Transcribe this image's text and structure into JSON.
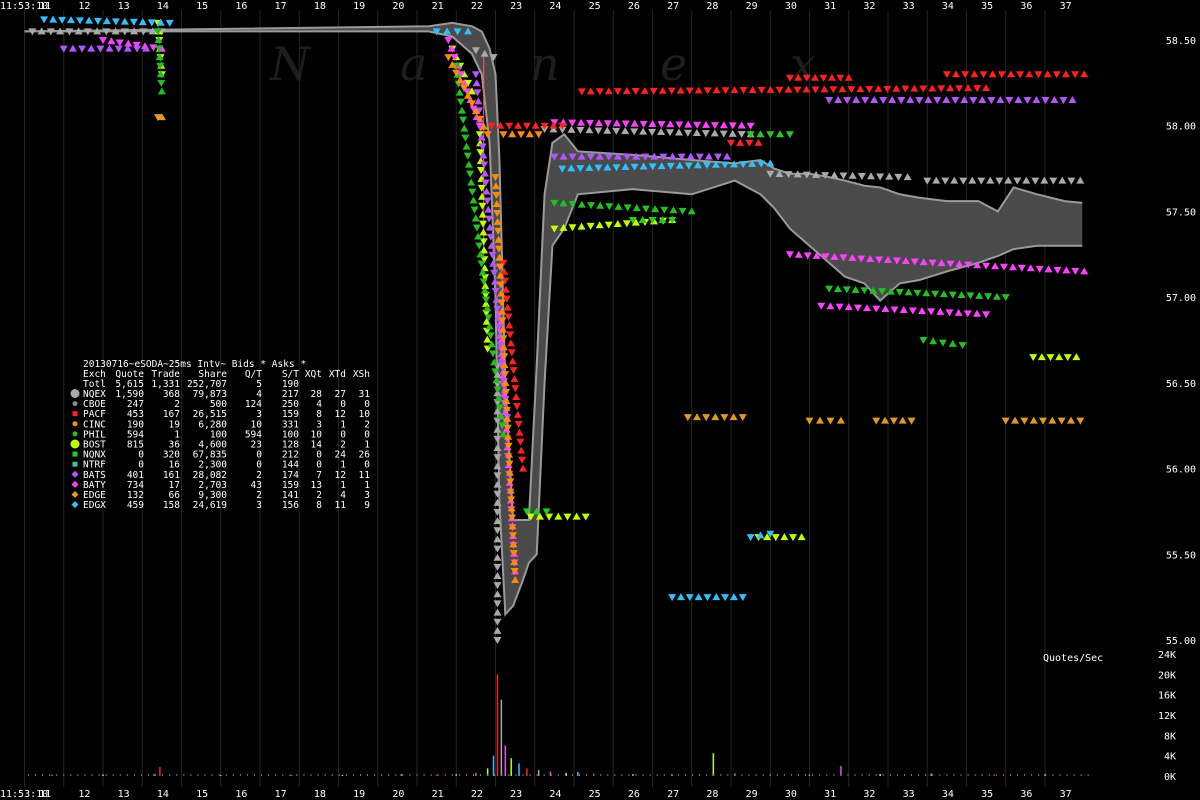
{
  "chart_data": {
    "type": "scatter",
    "watermark": [
      "N",
      "a",
      "n",
      "e",
      "x"
    ],
    "start_time": "11:53:10",
    "x_ticks": [
      11,
      12,
      13,
      14,
      15,
      16,
      17,
      18,
      19,
      20,
      21,
      22,
      23,
      24,
      25,
      26,
      27,
      28,
      29,
      30,
      31,
      32,
      33,
      34,
      35,
      36,
      37
    ],
    "price_axis": {
      "ylim": [
        54.9,
        58.66
      ],
      "ticks": [
        "58.50",
        "58.00",
        "57.50",
        "57.00",
        "56.50",
        "56.00",
        "55.50",
        "55.00"
      ]
    },
    "rate_axis": {
      "label": "Quotes/Sec",
      "ylim": [
        0,
        24000
      ],
      "ticks": [
        "24K",
        "20K",
        "16K",
        "12K",
        "8K",
        "4K",
        "0K"
      ]
    },
    "stats_table": {
      "title": "20130716~eSODA~25ms Intv~ Bids * Asks *",
      "columns": [
        "Exch",
        "Quote",
        "Trade",
        "Share",
        "Q/T",
        "S/T",
        "XQt",
        "XTd",
        "XSh"
      ],
      "total_row": [
        "Totl",
        "5,615",
        "1,331",
        "252,707",
        "5",
        "190",
        "",
        "",
        ""
      ],
      "rows": [
        {
          "cells": [
            "NQEX",
            "1,590",
            "368",
            "79,873",
            "4",
            "217",
            "28",
            "27",
            "31"
          ],
          "color": "#aaaaaa",
          "marker": "big-circle"
        },
        {
          "cells": [
            "CBOE",
            "247",
            "2",
            "500",
            "124",
            "250",
            "4",
            "0",
            "0"
          ],
          "color": "#8a8a8a",
          "marker": "circle"
        },
        {
          "cells": [
            "PACF",
            "453",
            "167",
            "26,515",
            "3",
            "159",
            "8",
            "12",
            "10"
          ],
          "color": "#ff2020",
          "marker": "square"
        },
        {
          "cells": [
            "CINC",
            "190",
            "19",
            "6,280",
            "10",
            "331",
            "3",
            "1",
            "2"
          ],
          "color": "#ff8c00",
          "marker": "circle"
        },
        {
          "cells": [
            "PHIL",
            "594",
            "1",
            "100",
            "594",
            "100",
            "10",
            "0",
            "0"
          ],
          "color": "#22c022",
          "marker": "circle"
        },
        {
          "cells": [
            "BOST",
            "815",
            "36",
            "4,600",
            "23",
            "128",
            "14",
            "2",
            "1"
          ],
          "color": "#c0ff00",
          "marker": "big-circle"
        },
        {
          "cells": [
            "NQNX",
            "0",
            "320",
            "67,835",
            "0",
            "212",
            "0",
            "24",
            "26"
          ],
          "color": "#22cc22",
          "marker": "square"
        },
        {
          "cells": [
            "NTRF",
            "0",
            "16",
            "2,300",
            "0",
            "144",
            "0",
            "1",
            "0"
          ],
          "color": "#30c8a0",
          "marker": "square"
        },
        {
          "cells": [
            "BATS",
            "401",
            "161",
            "28,082",
            "2",
            "174",
            "7",
            "12",
            "11"
          ],
          "color": "#b455ff",
          "marker": "diamond"
        },
        {
          "cells": [
            "BATY",
            "734",
            "17",
            "2,703",
            "43",
            "159",
            "13",
            "1",
            "1"
          ],
          "color": "#ff40ff",
          "marker": "diamond"
        },
        {
          "cells": [
            "EDGE",
            "132",
            "66",
            "9,300",
            "2",
            "141",
            "2",
            "4",
            "3"
          ],
          "color": "#e09a20",
          "marker": "diamond"
        },
        {
          "cells": [
            "EDGX",
            "459",
            "158",
            "24,619",
            "3",
            "156",
            "8",
            "11",
            "9"
          ],
          "color": "#30c0ff",
          "marker": "diamond"
        }
      ]
    },
    "nbbo_band": [
      [
        10.5,
        58.55,
        58.55
      ],
      [
        20.8,
        58.55,
        58.58
      ],
      [
        21.4,
        58.52,
        58.6
      ],
      [
        21.9,
        58.42,
        58.58
      ],
      [
        22.15,
        58.3,
        58.55
      ],
      [
        22.35,
        57.9,
        58.45
      ],
      [
        22.5,
        57.0,
        58.3
      ],
      [
        22.6,
        55.8,
        57.8
      ],
      [
        22.75,
        55.15,
        56.5
      ],
      [
        22.95,
        55.2,
        55.7
      ],
      [
        23.2,
        55.35,
        55.7
      ],
      [
        23.35,
        55.45,
        55.7
      ],
      [
        23.55,
        55.5,
        56.6
      ],
      [
        23.75,
        56.5,
        57.6
      ],
      [
        23.95,
        57.3,
        57.9
      ],
      [
        24.25,
        57.4,
        57.95
      ],
      [
        24.6,
        57.6,
        57.85
      ],
      [
        26.0,
        57.63,
        57.83
      ],
      [
        27.5,
        57.6,
        57.8
      ],
      [
        28.6,
        57.68,
        57.78
      ],
      [
        29.25,
        57.6,
        57.8
      ],
      [
        29.6,
        57.52,
        57.75
      ],
      [
        30.0,
        57.4,
        57.72
      ],
      [
        30.5,
        57.3,
        57.72
      ],
      [
        31.0,
        57.2,
        57.7
      ],
      [
        31.4,
        57.12,
        57.68
      ],
      [
        31.9,
        57.08,
        57.65
      ],
      [
        32.3,
        56.98,
        57.64
      ],
      [
        32.8,
        57.08,
        57.6
      ],
      [
        33.3,
        57.1,
        57.58
      ],
      [
        34.0,
        57.15,
        57.56
      ],
      [
        34.8,
        57.2,
        57.56
      ],
      [
        35.3,
        57.24,
        57.5
      ],
      [
        35.7,
        57.28,
        57.64
      ],
      [
        36.3,
        57.3,
        57.6
      ],
      [
        37.0,
        57.3,
        57.56
      ],
      [
        37.45,
        57.3,
        57.55
      ]
    ],
    "rate_peaks": [
      [
        21.0,
        300
      ],
      [
        21.5,
        400
      ],
      [
        22.0,
        600
      ],
      [
        22.3,
        1500
      ],
      [
        22.45,
        4000
      ],
      [
        22.55,
        20000
      ],
      [
        22.65,
        15000
      ],
      [
        22.75,
        6000
      ],
      [
        22.9,
        3500
      ],
      [
        23.1,
        2500
      ],
      [
        23.3,
        1500
      ],
      [
        23.6,
        1200
      ],
      [
        23.9,
        900
      ],
      [
        24.3,
        600
      ],
      [
        24.6,
        800
      ],
      [
        25.0,
        500
      ],
      [
        26.0,
        400
      ],
      [
        27.0,
        300
      ],
      [
        28.05,
        4500
      ],
      [
        28.6,
        500
      ],
      [
        29.5,
        400
      ],
      [
        30.5,
        300
      ],
      [
        31.3,
        2000
      ],
      [
        32.3,
        400
      ],
      [
        33.6,
        500
      ],
      [
        35.2,
        300
      ],
      [
        36.5,
        400
      ]
    ],
    "small_peaks": [
      [
        11.2,
        250
      ],
      [
        12.5,
        300
      ],
      [
        13.8,
        350
      ],
      [
        13.95,
        1800
      ],
      [
        15.5,
        200
      ],
      [
        17.3,
        200
      ],
      [
        18.6,
        200
      ],
      [
        20.1,
        350
      ]
    ],
    "quote_series": [
      {
        "exchange": "NQEX",
        "color": "#aaaaaa",
        "segments": [
          [
            10.7,
            58.55,
            14.0,
            58.55
          ],
          [
            22.0,
            58.44,
            22.45,
            58.4
          ],
          [
            22.55,
            56.6,
            22.55,
            55.0
          ],
          [
            23.75,
            57.98,
            29.0,
            57.95
          ],
          [
            29.5,
            57.72,
            33.0,
            57.7
          ],
          [
            33.5,
            57.68,
            37.4,
            57.68
          ]
        ]
      },
      {
        "exchange": "BOST",
        "color": "#c0ff00",
        "segments": [
          [
            13.9,
            58.6,
            14.0,
            58.3
          ],
          [
            21.4,
            58.45,
            21.9,
            58.2
          ],
          [
            22.1,
            57.95,
            22.3,
            56.7
          ],
          [
            23.4,
            55.72,
            24.8,
            55.72
          ],
          [
            24.0,
            57.4,
            27.0,
            57.45
          ],
          [
            29.2,
            55.6,
            30.3,
            55.6
          ],
          [
            36.2,
            56.65,
            37.3,
            56.65
          ]
        ]
      },
      {
        "exchange": "BATY",
        "color": "#ff40ff",
        "segments": [
          [
            12.5,
            58.5,
            14.0,
            58.45
          ],
          [
            21.3,
            58.5,
            22.1,
            58.0
          ],
          [
            22.6,
            56.9,
            23.0,
            55.4
          ],
          [
            24.0,
            58.02,
            29.0,
            58.0
          ],
          [
            30.0,
            57.25,
            37.5,
            57.15
          ],
          [
            30.8,
            56.95,
            35.0,
            56.9
          ]
        ]
      },
      {
        "exchange": "BATS",
        "color": "#b455ff",
        "segments": [
          [
            11.5,
            58.45,
            13.6,
            58.45
          ],
          [
            22.0,
            58.3,
            22.8,
            56.3
          ],
          [
            24.0,
            57.82,
            28.4,
            57.82
          ],
          [
            31.0,
            58.15,
            37.2,
            58.15
          ]
        ]
      },
      {
        "exchange": "EDGX",
        "color": "#30c0ff",
        "segments": [
          [
            11.0,
            58.62,
            14.2,
            58.6
          ],
          [
            21.0,
            58.55,
            21.8,
            58.55
          ],
          [
            24.2,
            57.75,
            29.5,
            57.78
          ],
          [
            27.0,
            55.25,
            28.8,
            55.25
          ],
          [
            29.0,
            55.6,
            29.5,
            55.62
          ]
        ]
      },
      {
        "exchange": "PACF",
        "color": "#ff2020",
        "segments": [
          [
            22.7,
            57.2,
            23.2,
            56.0
          ],
          [
            24.7,
            58.2,
            35.0,
            58.22
          ],
          [
            28.5,
            57.9,
            29.2,
            57.9
          ],
          [
            30.0,
            58.28,
            31.5,
            58.28
          ],
          [
            34.0,
            58.3,
            37.5,
            58.3
          ],
          [
            22.4,
            58.0,
            24.2,
            58.0
          ]
        ]
      },
      {
        "exchange": "PHIL",
        "color": "#22c022",
        "segments": [
          [
            13.9,
            58.55,
            14.0,
            58.2
          ],
          [
            21.5,
            58.35,
            22.7,
            56.2
          ],
          [
            24.0,
            57.55,
            27.5,
            57.5
          ],
          [
            31.0,
            57.05,
            35.5,
            57.0
          ],
          [
            33.4,
            56.75,
            34.4,
            56.72
          ]
        ]
      },
      {
        "exchange": "EDGE",
        "color": "#e09a20",
        "segments": [
          [
            27.4,
            56.3,
            28.8,
            56.3
          ],
          [
            30.5,
            56.28,
            31.3,
            56.28
          ],
          [
            32.2,
            56.28,
            33.1,
            56.28
          ],
          [
            35.5,
            56.28,
            37.4,
            56.28
          ],
          [
            13.9,
            58.05,
            14.0,
            58.05
          ]
        ]
      },
      {
        "exchange": "NQNX",
        "color": "#22cc22",
        "segments": [
          [
            23.3,
            55.75,
            23.8,
            55.75
          ],
          [
            26.0,
            57.45,
            27.0,
            57.45
          ],
          [
            29.0,
            57.95,
            30.0,
            57.95
          ]
        ]
      },
      {
        "exchange": "CINC",
        "color": "#ff8c00",
        "segments": [
          [
            21.3,
            58.4,
            22.3,
            57.95
          ],
          [
            22.7,
            57.95,
            23.6,
            57.95
          ],
          [
            22.5,
            57.7,
            23.0,
            55.35
          ]
        ]
      }
    ]
  }
}
